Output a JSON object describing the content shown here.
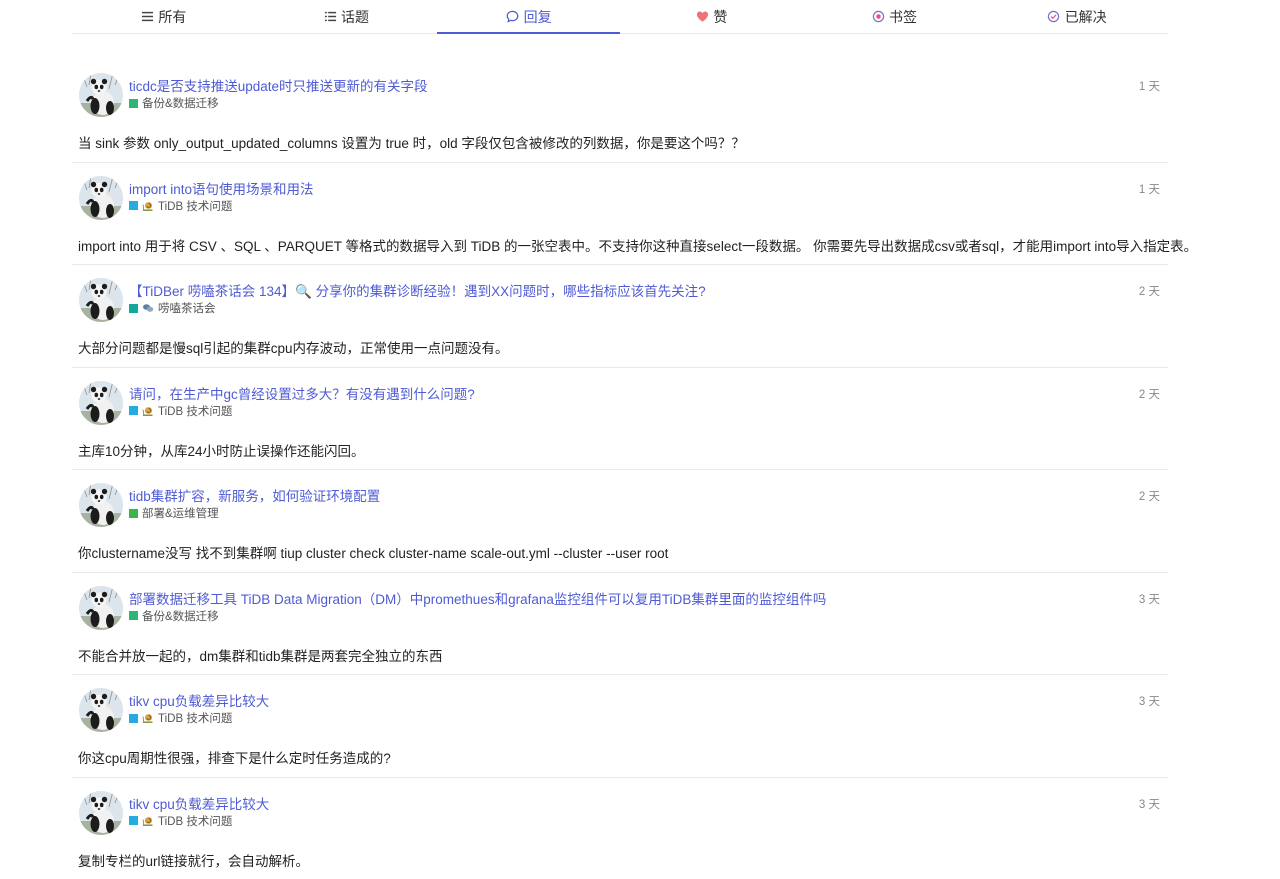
{
  "tabs": [
    {
      "label": "所有",
      "icon": "list-icon",
      "active": false
    },
    {
      "label": "话题",
      "icon": "bullet-list-icon",
      "active": false
    },
    {
      "label": "回复",
      "icon": "comment-icon",
      "active": true
    },
    {
      "label": "赞",
      "icon": "heart-icon",
      "active": false
    },
    {
      "label": "书签",
      "icon": "bookmark-icon",
      "active": false
    },
    {
      "label": "已解决",
      "icon": "check-circle-icon",
      "active": false
    }
  ],
  "colors": {
    "accent": "#4e5bd4",
    "heart": "#f0707c"
  },
  "posts": [
    {
      "title": "ticdc是否支持推送update时只推送更新的有关字段",
      "category": "备份&数据迁移",
      "category_color": "#2bb673",
      "category_icon": "",
      "time": "1 天",
      "excerpt": "当 sink 参数 only_output_updated_columns 设置为 true 时，old 字段仅包含被修改的列数据，你是要这个吗？？"
    },
    {
      "title": "import into语句使用场景和用法",
      "category": "TiDB 技术问题",
      "category_color": "#25aae1",
      "category_icon": "snail-icon",
      "time": "1 天",
      "excerpt": "import into 用于将 CSV 、SQL 、PARQUET 等格式的数据导入到 TiDB 的一张空表中。不支持你这种直接select一段数据。 你需要先导出数据成csv或者sql，才能用import into导入指定表。"
    },
    {
      "title": "【TiDBer 唠嗑茶话会 134】🔍 分享你的集群诊断经验！遇到XX问题时，哪些指标应该首先关注?",
      "category": "唠嗑茶话会",
      "category_color": "#12a89d",
      "category_icon": "chat-bubbles-icon",
      "time": "2 天",
      "excerpt": "大部分问题都是慢sql引起的集群cpu内存波动，正常使用一点问题没有。"
    },
    {
      "title": "请问，在生产中gc曾经设置过多大？有没有遇到什么问题?",
      "category": "TiDB 技术问题",
      "category_color": "#25aae1",
      "category_icon": "snail-icon",
      "time": "2 天",
      "excerpt": "主库10分钟，从库24小时防止误操作还能闪回。"
    },
    {
      "title": "tidb集群扩容，新服务，如何验证环境配置",
      "category": "部署&运维管理",
      "category_color": "#3ab54a",
      "category_icon": "",
      "time": "2 天",
      "excerpt": "你clustername没写 找不到集群啊 tiup cluster check cluster-name scale-out.yml --cluster --user root"
    },
    {
      "title": "部署数据迁移工具 TiDB Data Migration（DM）中promethues和grafana监控组件可以复用TiDB集群里面的监控组件吗",
      "category": "备份&数据迁移",
      "category_color": "#2bb673",
      "category_icon": "",
      "time": "3 天",
      "excerpt": "不能合并放一起的，dm集群和tidb集群是两套完全独立的东西"
    },
    {
      "title": "tikv cpu负载差异比较大",
      "category": "TiDB 技术问题",
      "category_color": "#25aae1",
      "category_icon": "snail-icon",
      "time": "3 天",
      "excerpt": "你这cpu周期性很强，排查下是什么定时任务造成的?"
    },
    {
      "title": "tikv cpu负载差异比较大",
      "category": "TiDB 技术问题",
      "category_color": "#25aae1",
      "category_icon": "snail-icon",
      "time": "3 天",
      "excerpt": "复制专栏的url链接就行，会自动解析。"
    }
  ]
}
